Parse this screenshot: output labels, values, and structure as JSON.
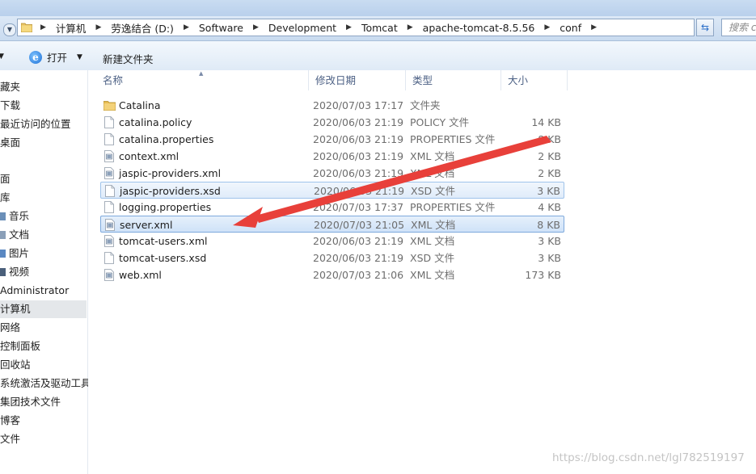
{
  "address_bar": {
    "segments": [
      "计算机",
      "劳逸结合 (D:)",
      "Software",
      "Development",
      "Tomcat",
      "apache-tomcat-8.5.56",
      "conf"
    ],
    "search_placeholder": "搜索 conf"
  },
  "toolbar": {
    "open_label": "打开",
    "new_folder_label": "新建文件夹"
  },
  "nav": {
    "items": [
      "藏夹",
      "下载",
      "最近访问的位置",
      "桌面",
      "面",
      "库",
      "音乐",
      "文档",
      "图片",
      "视频",
      "Administrator",
      "计算机",
      "网络",
      "控制面板",
      "回收站",
      "系统激活及驱动工具",
      "集团技术文件",
      "博客",
      "文件"
    ]
  },
  "columns": {
    "name": "名称",
    "date": "修改日期",
    "type": "类型",
    "size": "大小"
  },
  "files": [
    {
      "name": "Catalina",
      "date": "2020/07/03 17:17",
      "type": "文件夹",
      "size": "",
      "icon": "folder-icon"
    },
    {
      "name": "catalina.policy",
      "date": "2020/06/03 21:19",
      "type": "POLICY 文件",
      "size": "14 KB",
      "icon": "file-icon"
    },
    {
      "name": "catalina.properties",
      "date": "2020/06/03 21:19",
      "type": "PROPERTIES 文件",
      "size": "8 KB",
      "icon": "file-icon"
    },
    {
      "name": "context.xml",
      "date": "2020/06/03 21:19",
      "type": "XML 文档",
      "size": "2 KB",
      "icon": "xml-file-icon"
    },
    {
      "name": "jaspic-providers.xml",
      "date": "2020/06/03 21:19",
      "type": "XML 文档",
      "size": "2 KB",
      "icon": "xml-file-icon"
    },
    {
      "name": "jaspic-providers.xsd",
      "date": "2020/06/03 21:19",
      "type": "XSD 文件",
      "size": "3 KB",
      "icon": "file-icon"
    },
    {
      "name": "logging.properties",
      "date": "2020/07/03 17:37",
      "type": "PROPERTIES 文件",
      "size": "4 KB",
      "icon": "file-icon"
    },
    {
      "name": "server.xml",
      "date": "2020/07/03 21:05",
      "type": "XML 文档",
      "size": "8 KB",
      "icon": "xml-file-icon"
    },
    {
      "name": "tomcat-users.xml",
      "date": "2020/06/03 21:19",
      "type": "XML 文档",
      "size": "3 KB",
      "icon": "xml-file-icon"
    },
    {
      "name": "tomcat-users.xsd",
      "date": "2020/06/03 21:19",
      "type": "XSD 文件",
      "size": "3 KB",
      "icon": "file-icon"
    },
    {
      "name": "web.xml",
      "date": "2020/07/03 21:06",
      "type": "XML 文档",
      "size": "173 KB",
      "icon": "xml-file-icon"
    }
  ],
  "selected_file": "server.xml",
  "hovered_file": "jaspic-providers.xsd",
  "selected_nav": "计算机",
  "watermark": "https://blog.csdn.net/lgl782519197",
  "colors": {
    "annotation_arrow": "#e8403a",
    "selection_border": "#7ea9dc",
    "column_header_text": "#4d6185"
  }
}
